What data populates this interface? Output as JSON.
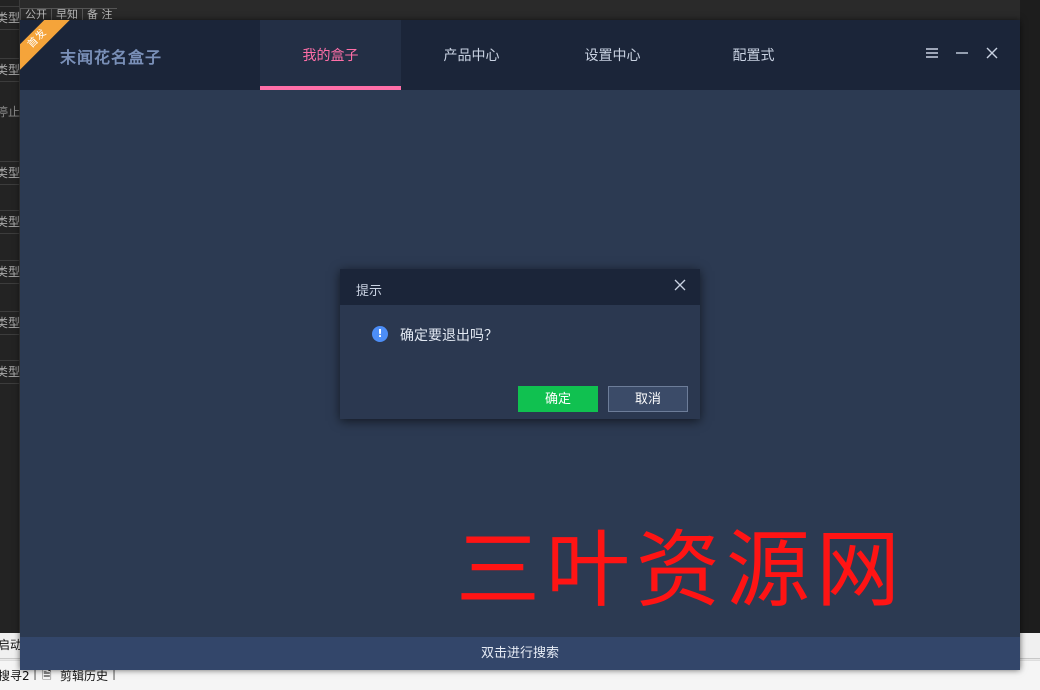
{
  "background_window": {
    "header_cells": [
      "公开",
      "早知",
      "备 注"
    ],
    "left_column_items": [
      "类型",
      "类型",
      "停止",
      "类型",
      "类型",
      "类型",
      "类型",
      "类型"
    ],
    "status_label": "启动",
    "bottom_items": [
      "搜寻2",
      "剪辑历史"
    ]
  },
  "app": {
    "badge_text": "首发",
    "title": "末闻花名盒子",
    "nav_tabs": [
      {
        "label": "我的盒子",
        "active": true
      },
      {
        "label": "产品中心",
        "active": false
      },
      {
        "label": "设置中心",
        "active": false
      },
      {
        "label": "配置式",
        "active": false
      }
    ],
    "window_controls": {
      "menu_icon": "menu-icon",
      "minimize_icon": "minimize-icon",
      "close_icon": "close-icon"
    },
    "footer_text": "双击进行搜索",
    "watermark": "三叶资源网",
    "colors": {
      "accent_tab": "#ff6fa8",
      "ok_button": "#10c150",
      "badge": "#f5a43a",
      "watermark": "#ff1414"
    }
  },
  "dialog": {
    "title": "提示",
    "icon": "info-icon",
    "message": "确定要退出吗？",
    "ok_label": "确定",
    "cancel_label": "取消"
  }
}
